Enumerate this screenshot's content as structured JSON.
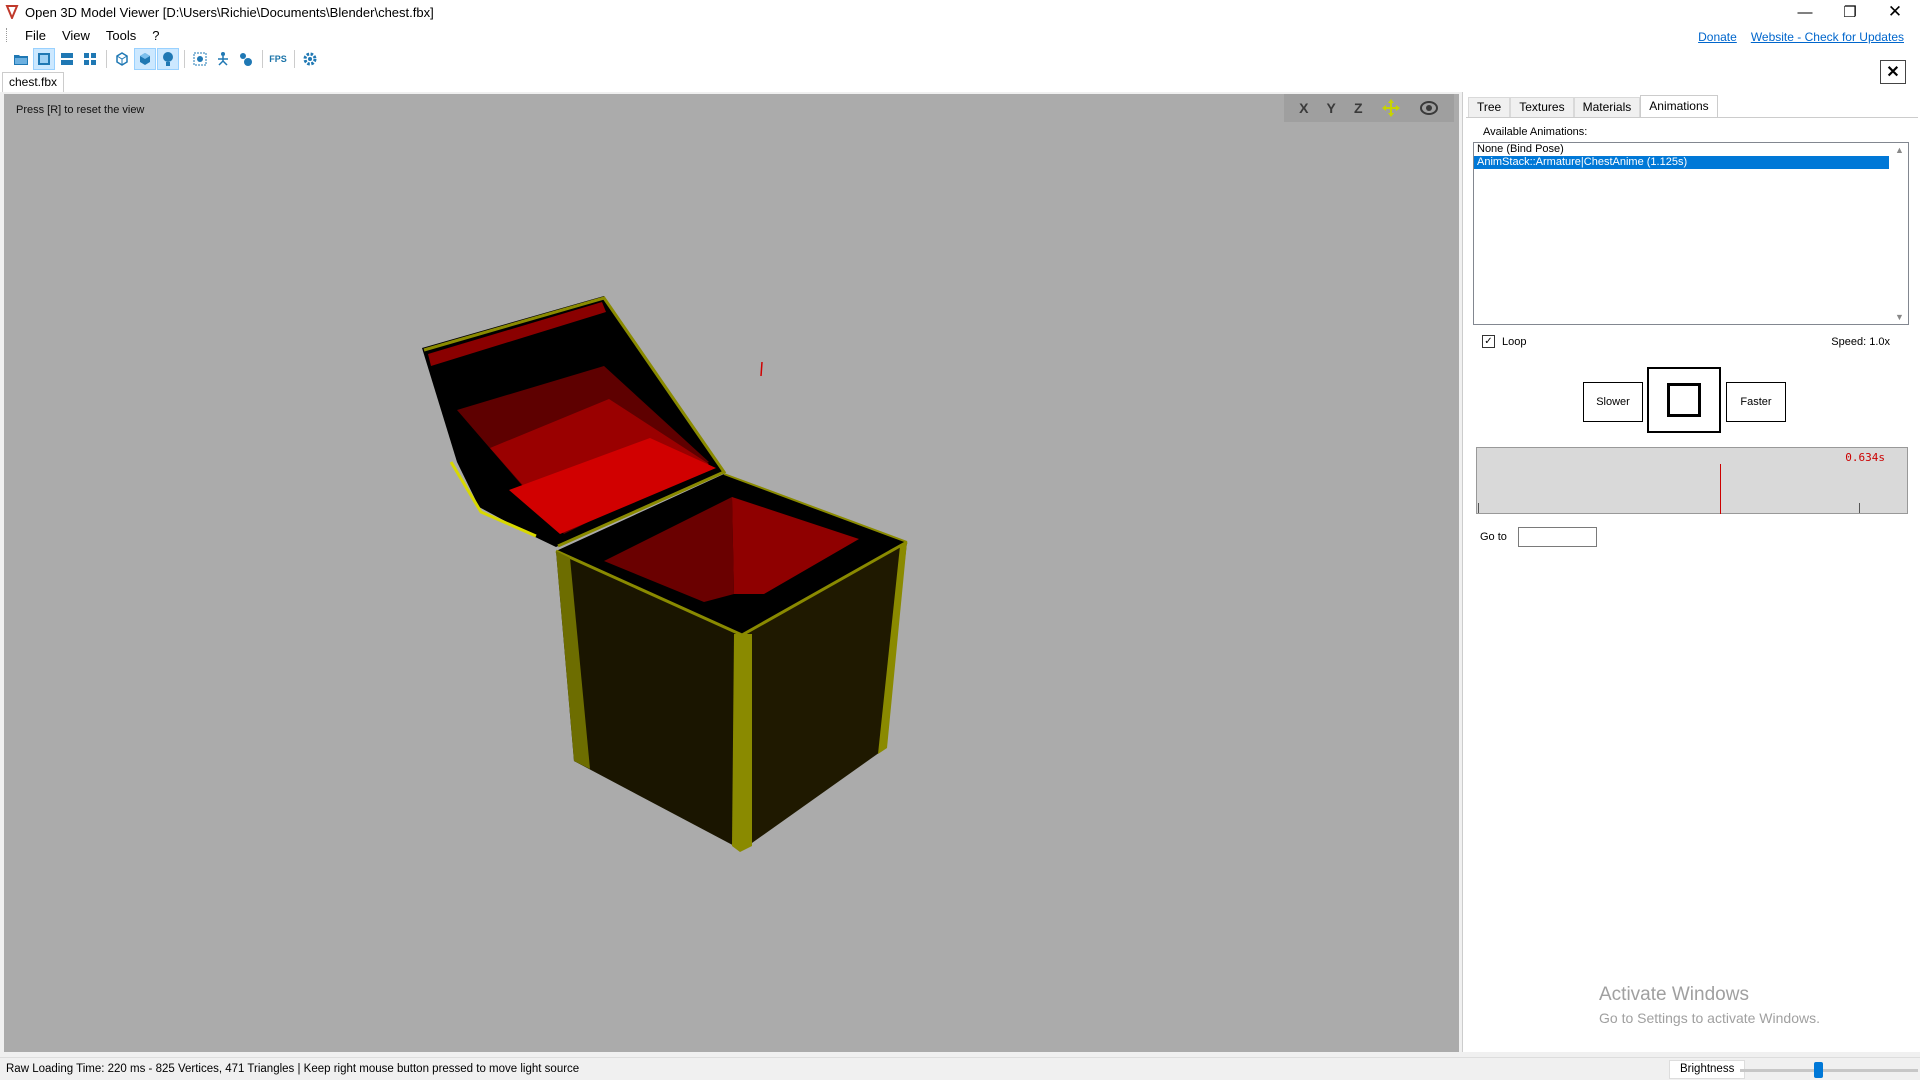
{
  "window": {
    "title": "Open 3D Model Viewer  [D:\\Users\\Richie\\Documents\\Blender\\chest.fbx]",
    "minimize_glyph": "—",
    "maximize_glyph": "❐",
    "close_glyph": "✕"
  },
  "menu": {
    "items": [
      "File",
      "View",
      "Tools",
      "?"
    ],
    "links": [
      "Donate",
      "Website - Check for Updates"
    ]
  },
  "toolbar": {
    "buttons": [
      "open-file-icon",
      "single-view-icon",
      "two-views-icon",
      "four-views-icon",
      "wireframe-icon",
      "solid-icon",
      "light-bulb-icon",
      "center-view-icon",
      "skeleton-icon",
      "shader-icon",
      "fps-icon",
      "settings-icon"
    ],
    "fps_label": "FPS"
  },
  "document_tab": {
    "label": "chest.fbx",
    "close_glyph": "✕"
  },
  "viewport": {
    "hint": "Press [R] to reset the view",
    "axes": [
      "X",
      "Y",
      "Z"
    ],
    "background": "#ababab"
  },
  "panel": {
    "tabs": [
      "Tree",
      "Textures",
      "Materials",
      "Animations"
    ],
    "active_tab": "Animations",
    "available_label": "Available Animations:",
    "animations": [
      "None (Bind Pose)",
      "AnimStack::Armature|ChestAnime (1.125s)"
    ],
    "selected_index": 1,
    "loop_label": "Loop",
    "loop_checked": true,
    "speed_label": "Speed:  1.0x",
    "slower_label": "Slower",
    "faster_label": "Faster",
    "timeline_time": "0.634s",
    "goto_label": "Go to",
    "goto_value": ""
  },
  "watermark": {
    "line1": "Activate Windows",
    "line2": "Go to Settings to activate Windows."
  },
  "statusbar": {
    "text": "Raw Loading Time: 220 ms - 825 Vertices, 471 Triangles  | Keep right mouse button pressed to move light source",
    "brightness_label": "Brightness",
    "brightness_fraction": 0.44
  },
  "colors": {
    "accent": "#0078d7",
    "timeline_marker": "#cc0000",
    "chest_trim": "#8a8a00",
    "chest_inner": "#d10000"
  }
}
